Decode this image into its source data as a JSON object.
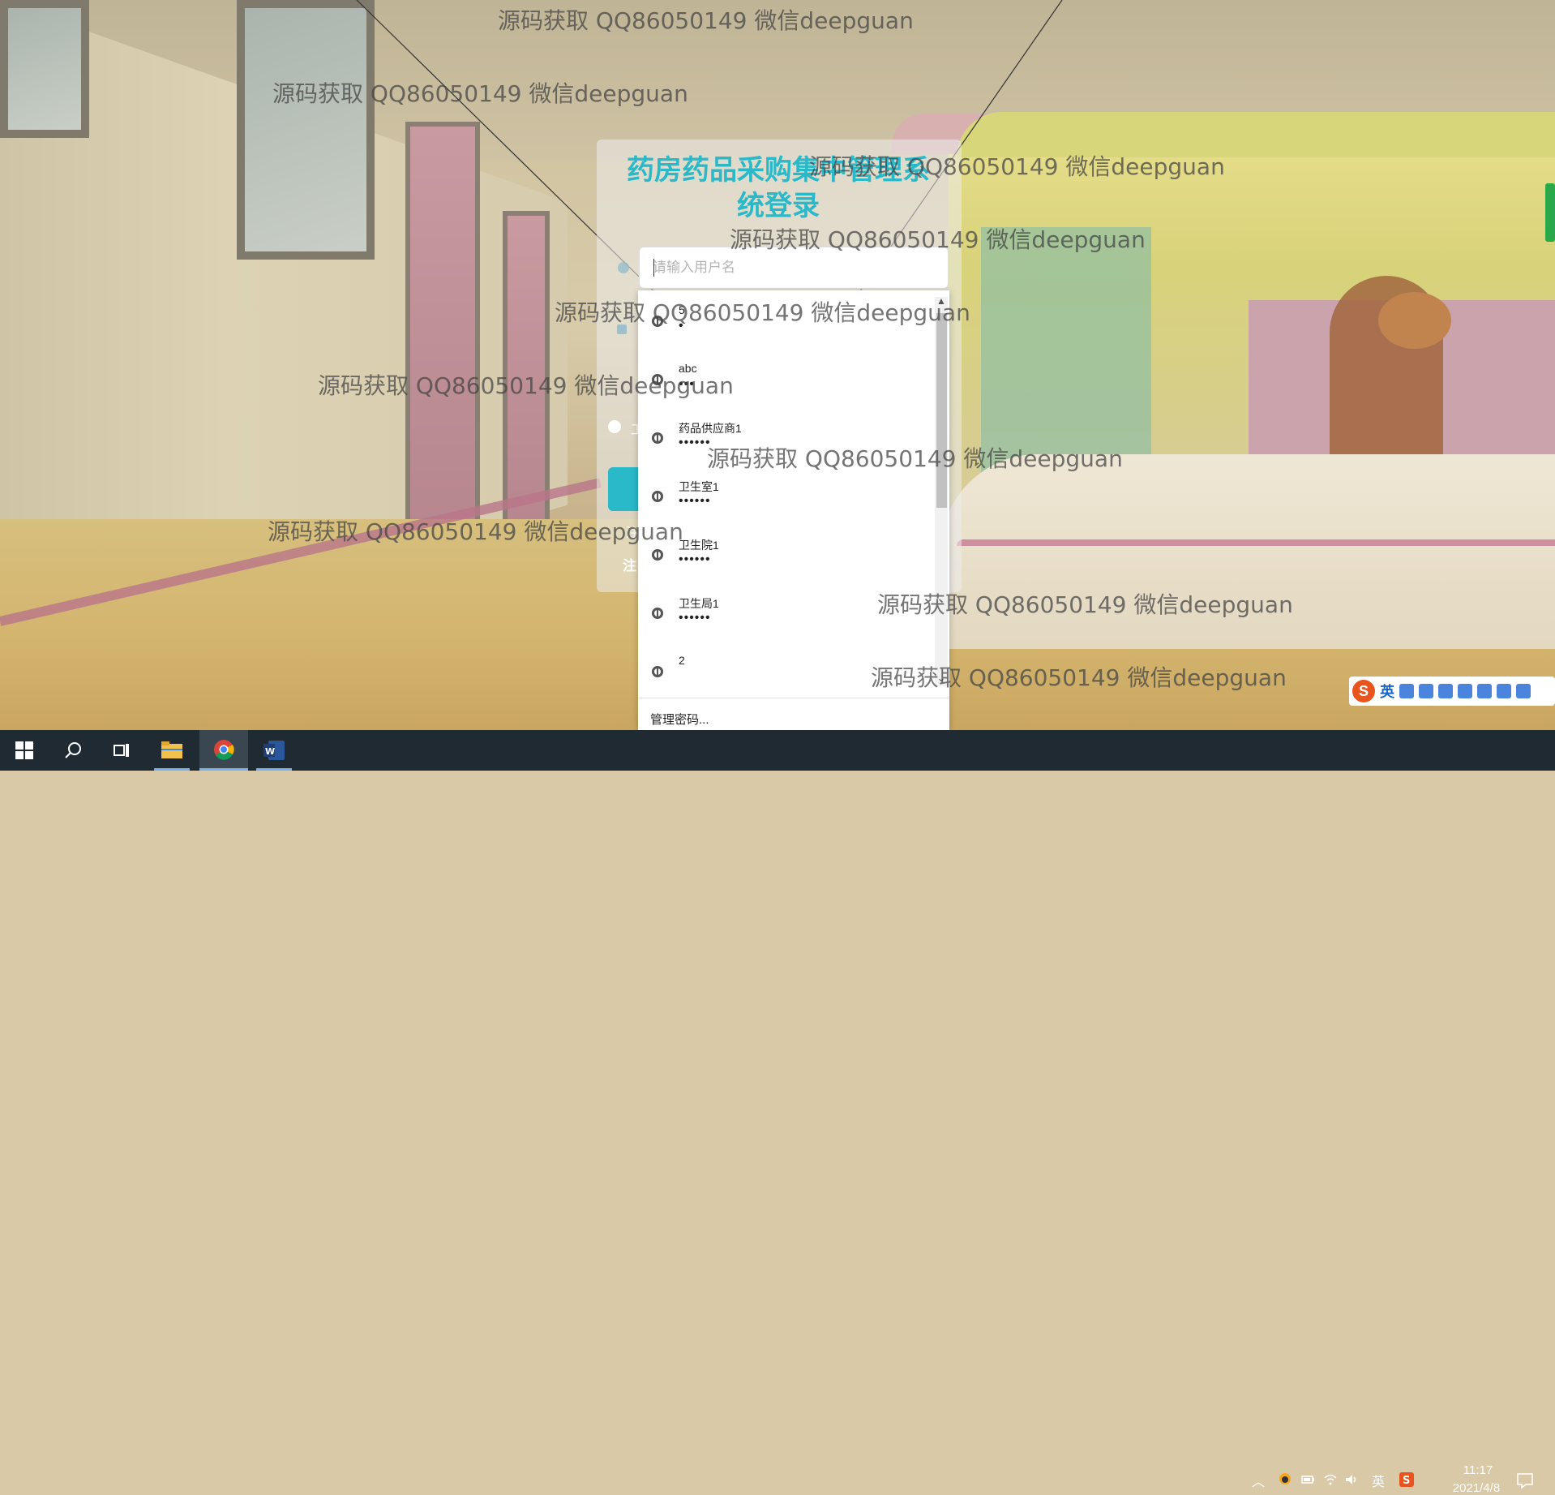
{
  "login": {
    "title": "药房药品采购集中管理系统登录",
    "username_placeholder": "请输入用户名",
    "username_value": "",
    "role_option_partial": "工",
    "left_label_partial": "注",
    "register_partial": "注"
  },
  "autocomplete": {
    "entries": [
      {
        "user": "5",
        "password": "•"
      },
      {
        "user": "abc",
        "password": "•••"
      },
      {
        "user": "药品供应商1",
        "password": "••••••"
      },
      {
        "user": "卫生室1",
        "password": "••••••"
      },
      {
        "user": "卫生院1",
        "password": "••••••"
      },
      {
        "user": "卫生局1",
        "password": "••••••"
      },
      {
        "user": "2",
        "password": ""
      }
    ],
    "manage_label": "管理密码..."
  },
  "watermark": {
    "text": "源码获取 QQ86050149 微信deepguan"
  },
  "ime": {
    "logo": "S",
    "lang": "英"
  },
  "taskbar": {
    "tray_lang": "英",
    "time": "11:17",
    "date": "2021/4/8"
  },
  "colors": {
    "accent": "#29b9c9",
    "taskbar": "#1f2a33",
    "ime_logo": "#e9531e"
  },
  "icons": {
    "start": "windows-start-icon",
    "search": "search-icon",
    "taskview": "task-view-icon",
    "explorer": "file-explorer-icon",
    "chrome": "chrome-icon",
    "word": "word-icon",
    "entry": "globe-key-icon"
  }
}
